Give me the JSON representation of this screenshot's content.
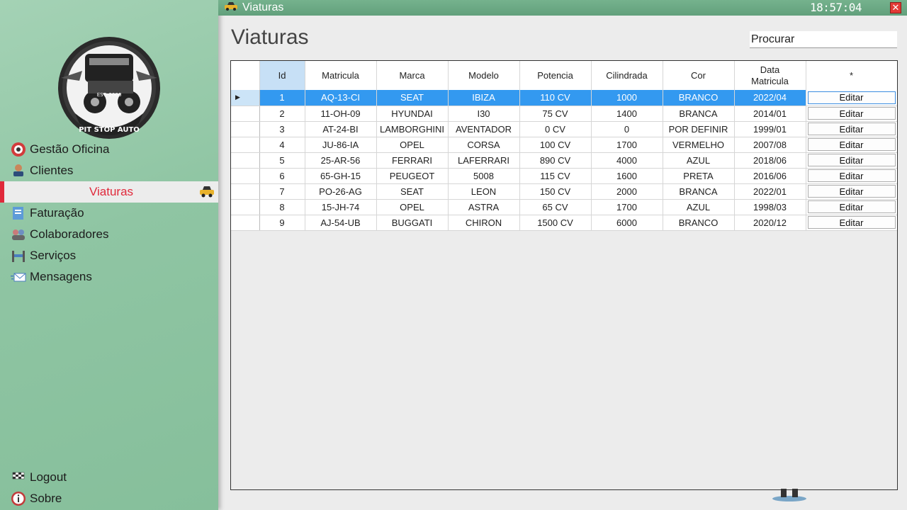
{
  "window": {
    "title": "Viaturas",
    "clock": "18:57:04",
    "close_label": "✕"
  },
  "sidebar": {
    "logo_text": "PIT STOP AUTO",
    "logo_est": "EST. 2006",
    "items": [
      {
        "label": "Gestão Oficina",
        "icon": "wheel-icon"
      },
      {
        "label": "Clientes",
        "icon": "client-icon"
      },
      {
        "label": "Viaturas",
        "icon": "car-icon",
        "active": true
      },
      {
        "label": "Faturação",
        "icon": "invoice-icon"
      },
      {
        "label": "Colaboradores",
        "icon": "people-icon"
      },
      {
        "label": "Serviços",
        "icon": "lift-icon"
      },
      {
        "label": "Mensagens",
        "icon": "mail-icon"
      }
    ],
    "bottom": [
      {
        "label": "Logout",
        "icon": "flag-icon"
      },
      {
        "label": "Sobre",
        "icon": "info-icon"
      }
    ]
  },
  "main": {
    "title": "Viaturas",
    "search_value": "Procurar"
  },
  "grid": {
    "headers": {
      "id": "Id",
      "matricula": "Matricula",
      "marca": "Marca",
      "modelo": "Modelo",
      "potencia": "Potencia",
      "cilindrada": "Cilindrada",
      "cor": "Cor",
      "data_1": "Data",
      "data_2": "Matricula",
      "action": "*"
    },
    "edit_label": "Editar",
    "row_marker": "▶",
    "rows": [
      {
        "id": "1",
        "matricula": "AQ-13-CI",
        "marca": "SEAT",
        "modelo": "IBIZA",
        "potencia": "110 CV",
        "cilindrada": "1000",
        "cor": "BRANCO",
        "data": "2022/04",
        "selected": true
      },
      {
        "id": "2",
        "matricula": "11-OH-09",
        "marca": "HYUNDAI",
        "modelo": "I30",
        "potencia": "75 CV",
        "cilindrada": "1400",
        "cor": "BRANCA",
        "data": "2014/01"
      },
      {
        "id": "3",
        "matricula": "AT-24-BI",
        "marca": "LAMBORGHINI",
        "modelo": "AVENTADOR",
        "potencia": "0 CV",
        "cilindrada": "0",
        "cor": "POR DEFINIR",
        "data": "1999/01"
      },
      {
        "id": "4",
        "matricula": "JU-86-IA",
        "marca": "OPEL",
        "modelo": "CORSA",
        "potencia": "100 CV",
        "cilindrada": "1700",
        "cor": "VERMELHO",
        "data": "2007/08"
      },
      {
        "id": "5",
        "matricula": "25-AR-56",
        "marca": "FERRARI",
        "modelo": "LAFERRARI",
        "potencia": "890 CV",
        "cilindrada": "4000",
        "cor": "AZUL",
        "data": "2018/06"
      },
      {
        "id": "6",
        "matricula": "65-GH-15",
        "marca": "PEUGEOT",
        "modelo": "5008",
        "potencia": "115 CV",
        "cilindrada": "1600",
        "cor": "PRETA",
        "data": "2016/06"
      },
      {
        "id": "7",
        "matricula": "PO-26-AG",
        "marca": "SEAT",
        "modelo": "LEON",
        "potencia": "150 CV",
        "cilindrada": "2000",
        "cor": "BRANCA",
        "data": "2022/01"
      },
      {
        "id": "8",
        "matricula": "15-JH-74",
        "marca": "OPEL",
        "modelo": "ASTRA",
        "potencia": "65 CV",
        "cilindrada": "1700",
        "cor": "AZUL",
        "data": "1998/03"
      },
      {
        "id": "9",
        "matricula": "AJ-54-UB",
        "marca": "BUGGATI",
        "modelo": "CHIRON",
        "potencia": "1500 CV",
        "cilindrada": "6000",
        "cor": "BRANCO",
        "data": "2020/12"
      }
    ]
  },
  "colors": {
    "sidebar": "#8fc5a3",
    "titlebar": "#6aa884",
    "active_accent": "#e0293b",
    "selection": "#3399f0"
  }
}
